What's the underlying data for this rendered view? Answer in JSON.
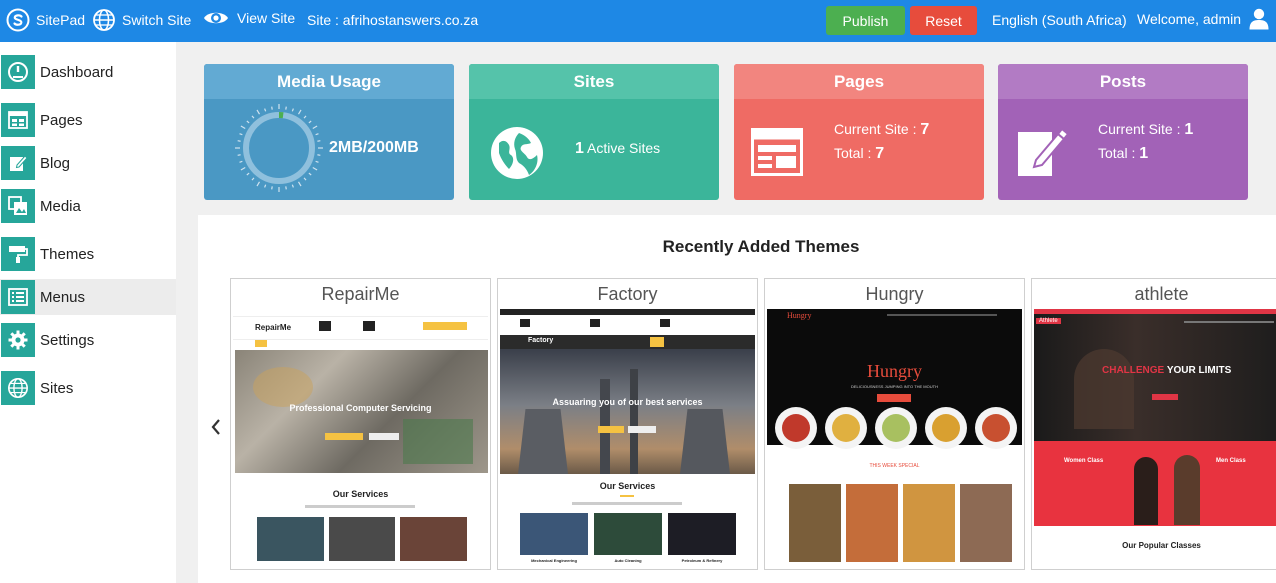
{
  "topbar": {
    "brand": "SitePad",
    "switch_site": "Switch Site",
    "view_site": "View Site",
    "site_label": "Site : afrihostanswers.co.za",
    "publish": "Publish",
    "reset": "Reset",
    "language": "English (South Africa)",
    "welcome": "Welcome, admin"
  },
  "sidebar": {
    "items": [
      {
        "label": "Dashboard",
        "icon": "dashboard-icon"
      },
      {
        "label": "Pages",
        "icon": "pages-icon"
      },
      {
        "label": "Blog",
        "icon": "blog-icon"
      },
      {
        "label": "Media",
        "icon": "media-icon"
      },
      {
        "label": "Themes",
        "icon": "themes-icon"
      },
      {
        "label": "Menus",
        "icon": "menus-icon"
      },
      {
        "label": "Settings",
        "icon": "gear-icon"
      },
      {
        "label": "Sites",
        "icon": "globe-icon"
      }
    ],
    "active": "Menus"
  },
  "stats": {
    "media": {
      "title": "Media Usage",
      "value": "2MB/200MB",
      "used_fraction": 0.01
    },
    "sites": {
      "title": "Sites",
      "count": "1",
      "label": "Active Sites"
    },
    "pages": {
      "title": "Pages",
      "current_label": "Current Site :",
      "current": "7",
      "total_label": "Total :",
      "total": "7"
    },
    "posts": {
      "title": "Posts",
      "current_label": "Current Site :",
      "current": "1",
      "total_label": "Total :",
      "total": "1"
    }
  },
  "themes": {
    "title": "Recently Added Themes",
    "items": [
      {
        "name": "RepairMe",
        "logo": "RepairMe",
        "hero": "Professional Computer Servicing",
        "section": "Our Services"
      },
      {
        "name": "Factory",
        "logo": "Factory",
        "hero": "Assuaring you of our best services",
        "section": "Our Services",
        "services": [
          "Mechanical Engineering",
          "Auto Cleaning",
          "Petroleum & Refinery"
        ]
      },
      {
        "name": "Hungry",
        "logo": "Hungry",
        "hero": "Hungry",
        "tagline": "DELICIOUSNESS JUMPING INTO THE MOUTH",
        "special": "THIS WEEK SPECIAL"
      },
      {
        "name": "athlete",
        "logo": "Athlete",
        "hero_accent": "CHALLENGE",
        "hero": "YOUR LIMITS",
        "women": "Women Class",
        "men": "Men Class",
        "section": "Our Popular Classes"
      }
    ]
  },
  "colors": {
    "topbar": "#1e88e5",
    "sidebar_icon": "#26a69a",
    "media": "#4a98c4",
    "sites": "#3bb59a",
    "pages": "#ef6b64",
    "posts": "#a262b7"
  }
}
